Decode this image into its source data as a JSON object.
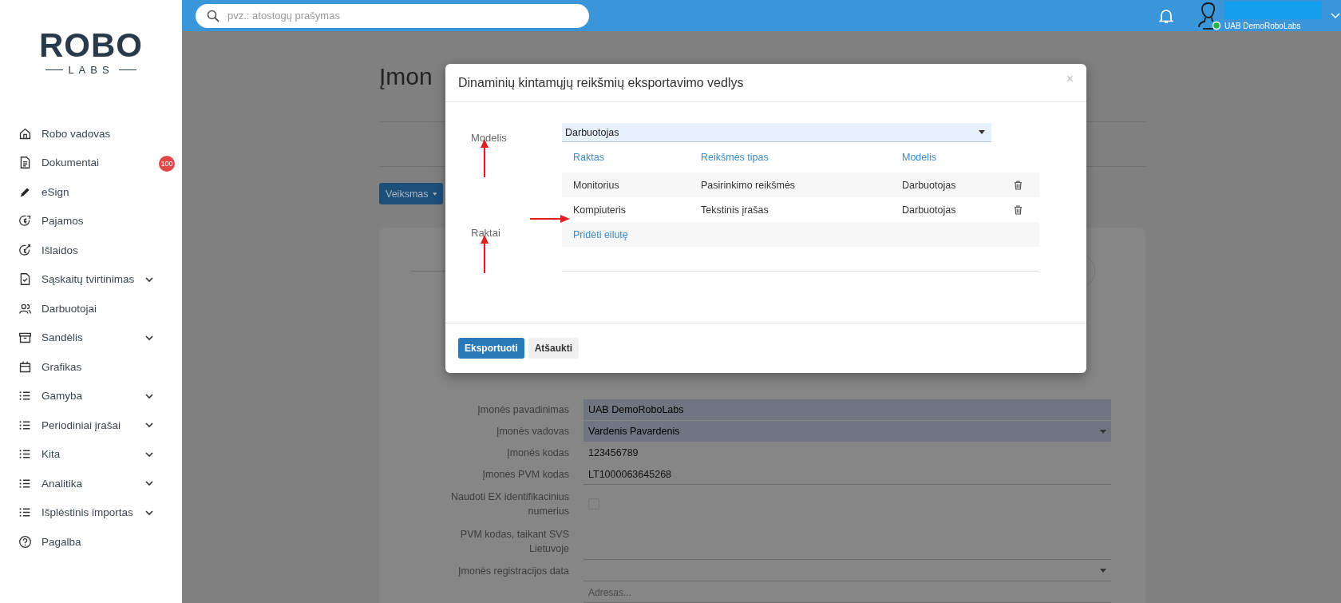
{
  "sidebar": {
    "logo": {
      "wordmark": "ROBO",
      "subline": "LABS"
    },
    "items": [
      {
        "label": "Robo vadovas",
        "expandable": false
      },
      {
        "label": "Dokumentai",
        "expandable": false,
        "badge": "100"
      },
      {
        "label": "eSign",
        "expandable": false
      },
      {
        "label": "Pajamos",
        "expandable": false
      },
      {
        "label": "Išlaidos",
        "expandable": false
      },
      {
        "label": "Sąskaitų tvirtinimas",
        "expandable": true
      },
      {
        "label": "Darbuotojai",
        "expandable": false
      },
      {
        "label": "Sandėlis",
        "expandable": true
      },
      {
        "label": "Grafikas",
        "expandable": false
      },
      {
        "label": "Gamyba",
        "expandable": true
      },
      {
        "label": "Periodiniai įrašai",
        "expandable": true
      },
      {
        "label": "Kita",
        "expandable": true
      },
      {
        "label": "Analitika",
        "expandable": true
      },
      {
        "label": "Išplėstinis importas",
        "expandable": true
      },
      {
        "label": "Pagalba",
        "expandable": false
      }
    ]
  },
  "topbar": {
    "search": {
      "placeholder": "pvz.: atostogų prašymas"
    },
    "company": "UAB DemoRoboLabs"
  },
  "page": {
    "title": "Įmon",
    "action_button": "Veiksmas",
    "form": [
      {
        "label": "Įmonės pavadinimas",
        "kind": "filled",
        "value": "UAB DemoRoboLabs"
      },
      {
        "label": "Įmonės vadovas",
        "kind": "filled-select",
        "value": "Vardenis Pavardenis"
      },
      {
        "label": "Įmonės kodas",
        "kind": "plain",
        "value": "123456789"
      },
      {
        "label": "Įmonės PVM kodas",
        "kind": "underline",
        "value": "LT1000063645268"
      },
      {
        "label": "Naudoti EX identifikacinius numerius",
        "kind": "checkbox",
        "checked": false
      },
      {
        "label": "PVM kodas, taikant SVS Lietuvoje",
        "kind": "underline"
      },
      {
        "label": "Įmonės registracijos data",
        "kind": "select"
      },
      {
        "kind": "underline",
        "placeholder": "Adresas..."
      }
    ]
  },
  "modal": {
    "title": "Dinaminių kintamųjų reikšmių eksportavimo vedlys",
    "close": "×",
    "model_label": "Modelis",
    "keys_label": "Raktai",
    "model_select": {
      "value": "Darbuotojas"
    },
    "table": {
      "columns": [
        "Raktas",
        "Reikšmės tipas",
        "Modelis"
      ],
      "rows": [
        [
          "Monitorius",
          "Pasirinkimo reikšmės",
          "Darbuotojas"
        ],
        [
          "Kompiuteris",
          "Tekstinis įrašas",
          "Darbuotojas"
        ]
      ]
    },
    "add_row": "Pridėti eilutę",
    "buttons": [
      {
        "label": "Eksportuoti",
        "kind": "primary"
      },
      {
        "label": "Atšaukti",
        "kind": "default"
      }
    ]
  }
}
